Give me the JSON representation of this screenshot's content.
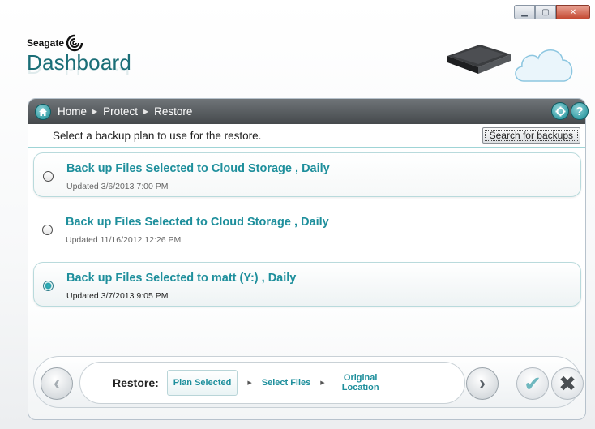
{
  "window": {
    "controls": {
      "minimize": "▁",
      "maximize": "▢",
      "close": "✕"
    }
  },
  "logo": {
    "brand": "Seagate",
    "product": "Dashboard"
  },
  "breadcrumb": {
    "items": [
      "Home",
      "Protect",
      "Restore"
    ],
    "icons": [
      "home-icon",
      "settings-icon",
      "help-icon"
    ],
    "help": "?"
  },
  "instruction": "Select a backup plan to use for the restore.",
  "search_button": "Search for backups",
  "plans": [
    {
      "title": "Back up Files Selected to Cloud Storage , Daily",
      "updated": "Updated 3/6/2013 7:00 PM",
      "selected": false
    },
    {
      "title": "Back up Files Selected to Cloud Storage , Daily",
      "updated": "Updated 11/16/2012 12:26 PM",
      "selected": false
    },
    {
      "title": "Back up Files Selected to matt (Y:) , Daily",
      "updated": "Updated 3/7/2013 9:05 PM",
      "selected": true
    }
  ],
  "wizard": {
    "label": "Restore:",
    "steps": [
      "Plan Selected",
      "Select Files",
      "Original Location"
    ],
    "active_step": "Plan Selected",
    "prev": "‹",
    "next": "›",
    "ok": "✔",
    "cancel": "✖"
  },
  "colors": {
    "accent": "#1e8f9c",
    "bar": "#45494c"
  }
}
